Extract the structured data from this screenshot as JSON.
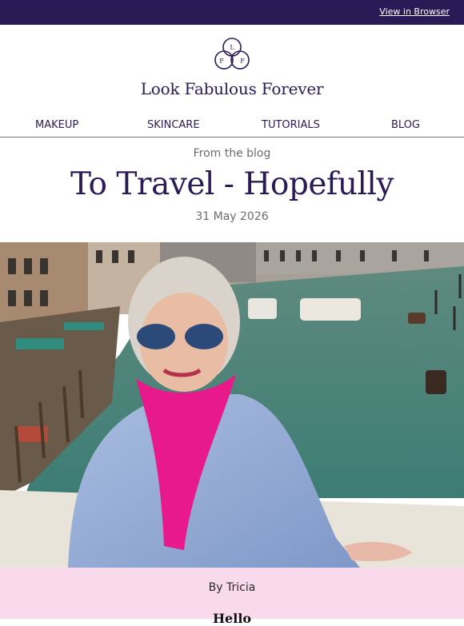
{
  "topbar": {
    "view_in_browser": "View in Browser"
  },
  "brand": {
    "name": "Look Fabulous Forever",
    "logo_letters": [
      "L",
      "F",
      "F"
    ]
  },
  "nav": {
    "items": [
      "MAKEUP",
      "SKINCARE",
      "TUTORIALS",
      "BLOG"
    ]
  },
  "article": {
    "eyebrow": "From the blog",
    "title": "To Travel - Hopefully",
    "date": "31 May 2026",
    "byline": "By Tricia",
    "greeting": "Hello"
  },
  "colors": {
    "brand_navy": "#2a1a55",
    "byline_pink": "#f9d9ec",
    "accent_pink": "#e62f84"
  }
}
